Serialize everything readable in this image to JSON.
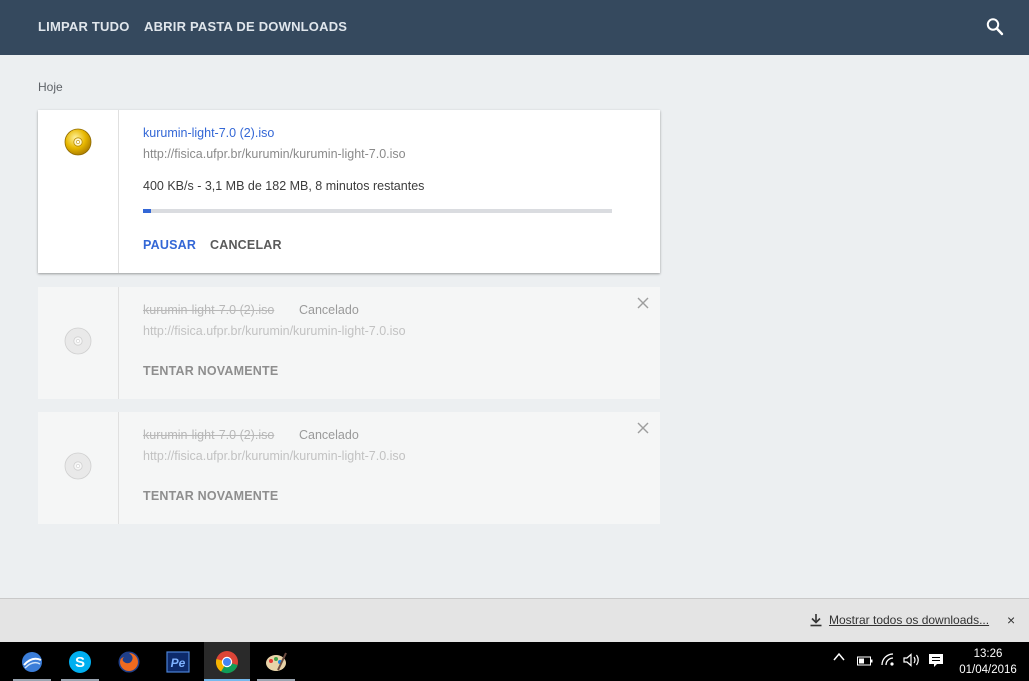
{
  "header": {
    "clear_all": "LIMPAR TUDO",
    "open_folder": "ABRIR PASTA DE DOWNLOADS",
    "search_icon": "search-icon"
  },
  "section_label": "Hoje",
  "downloads": [
    {
      "filename": "kurumin-light-7.0 (2).iso",
      "url": "http://fisica.ufpr.br/kurumin/kurumin-light-7.0.iso",
      "progress_text": "400 KB/s - 3,1 MB de 182 MB, 8 minutos restantes",
      "progress_fraction": 0.017,
      "pause": "PAUSAR",
      "cancel": "CANCELAR",
      "icon": "disc-icon"
    },
    {
      "filename": "kurumin-light-7.0 (2).iso",
      "status": "Cancelado",
      "url": "http://fisica.ufpr.br/kurumin/kurumin-light-7.0.iso",
      "retry": "TENTAR NOVAMENTE",
      "icon": "disc-icon"
    },
    {
      "filename": "kurumin-light-7.0 (2).iso",
      "status": "Cancelado",
      "url": "http://fisica.ufpr.br/kurumin/kurumin-light-7.0.iso",
      "retry": "TENTAR NOVAMENTE",
      "icon": "disc-icon"
    }
  ],
  "shelf": {
    "show_all": "Mostrar todos os downloads...",
    "close": "×"
  },
  "taskbar": {
    "apps": [
      "browser-app-icon",
      "skype-icon",
      "firefox-icon",
      "photoshop-elements-icon",
      "chrome-icon",
      "paint-icon"
    ],
    "time": "13:26",
    "date": "01/04/2016"
  },
  "colors": {
    "header_bg": "#35495e",
    "accent": "#3367d6",
    "page_bg": "#eceff1"
  }
}
